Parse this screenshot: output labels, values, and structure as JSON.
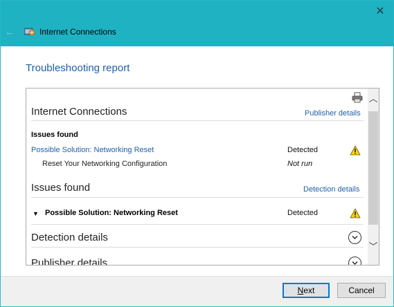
{
  "window": {
    "title": "Internet Connections",
    "close_glyph": "✕",
    "back_glyph": "←"
  },
  "report": {
    "title": "Troubleshooting report"
  },
  "section_connections": {
    "heading": "Internet Connections",
    "link": "Publisher details",
    "issues_heading": "Issues found",
    "solution_label": "Possible Solution: Networking Reset",
    "solution_status": "Detected",
    "sub_item_label": "Reset Your Networking Configuration",
    "sub_item_status": "Not run"
  },
  "section_issues": {
    "heading": "Issues found",
    "link": "Detection details",
    "expand_glyph": "▼",
    "row_label": "Possible Solution: Networking Reset",
    "row_status": "Detected"
  },
  "section_detection": {
    "heading": "Detection details"
  },
  "section_publisher": {
    "heading": "Publisher details"
  },
  "scrollbar": {
    "up_glyph": "︿",
    "down_glyph": "﹀"
  },
  "buttons": {
    "next_label": "Next",
    "cancel_label": "Cancel"
  },
  "colors": {
    "titlebar": "#1fb2c3",
    "link_blue": "#1f5fa8",
    "warning_yellow": "#f5d11b",
    "default_button_border": "#0078d7"
  },
  "icons": {
    "app": "internet-connections-icon",
    "print": "printer-icon",
    "warning": "warning-triangle-icon",
    "expand": "chevron-circle-down-icon"
  }
}
